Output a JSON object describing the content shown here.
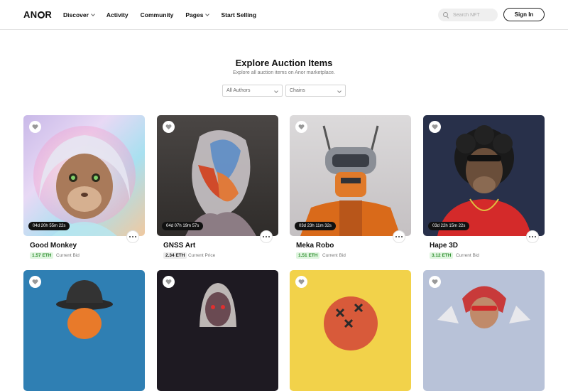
{
  "header": {
    "logo": "ANOR",
    "nav": [
      {
        "label": "Discover",
        "dropdown": true
      },
      {
        "label": "Activity",
        "dropdown": false
      },
      {
        "label": "Community",
        "dropdown": false
      },
      {
        "label": "Pages",
        "dropdown": true
      },
      {
        "label": "Start Selling",
        "dropdown": false
      }
    ],
    "search_placeholder": "Search NFT",
    "signin_label": "Sign In"
  },
  "hero": {
    "title": "Explore Auction Items",
    "subtitle": "Explore all auction items on Anor marketplace."
  },
  "filters": {
    "authors": "All Authors",
    "chains": "Chains"
  },
  "cards": [
    {
      "name": "Good Monkey",
      "timer": "04d 20h 55m 22s",
      "price": "1.57 ETH",
      "price_label": "Current Bid",
      "price_style": "green",
      "icon": "heart-icon"
    },
    {
      "name": "GNSS Art",
      "timer": "04d 07h 19m 57s",
      "price": "2.34 ETH",
      "price_label": "Current Price",
      "price_style": "gray",
      "icon": "heart-icon"
    },
    {
      "name": "Meka Robo",
      "timer": "03d 23h 11m 32s",
      "price": "1.51 ETH",
      "price_label": "Current Bid",
      "price_style": "green",
      "icon": "heart-icon"
    },
    {
      "name": "Hape 3D",
      "timer": "03d 22h 15m 22s",
      "price": "3.12 ETH",
      "price_label": "Current Bid",
      "price_style": "green",
      "icon": "heart-icon"
    }
  ],
  "colors": {
    "accent_green": "#2f8f2f",
    "badge_green_bg": "#dff5df",
    "timer_bg": "#111111"
  }
}
